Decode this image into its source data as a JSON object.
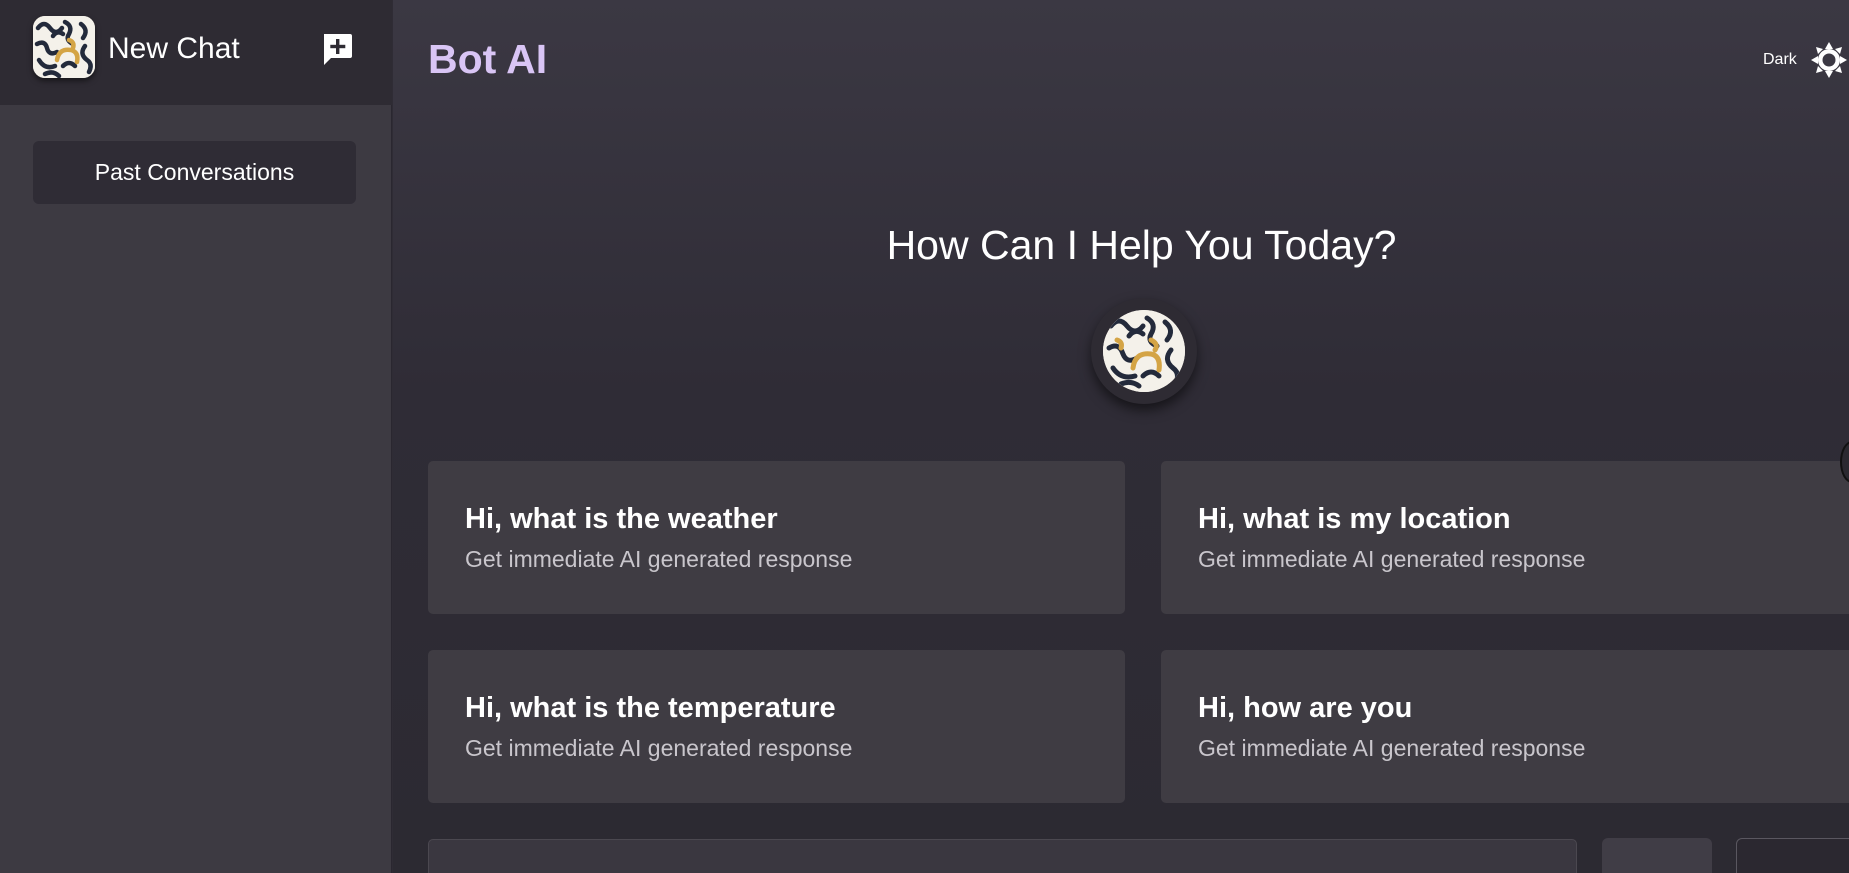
{
  "sidebar": {
    "logo_icon": "doodle-logo-icon",
    "new_chat_label": "New Chat",
    "new_chat_icon": "add-chat-icon",
    "past_conversations_label": "Past Conversations"
  },
  "header": {
    "title": "Bot AI",
    "theme_label": "Dark",
    "theme_icon": "sun-icon"
  },
  "main": {
    "headline": "How Can I Help You Today?",
    "avatar_icon": "doodle-logo-icon",
    "suggestions": [
      {
        "title": "Hi, what is the weather",
        "subtitle": "Get immediate AI generated response"
      },
      {
        "title": "Hi, what is my location",
        "subtitle": "Get immediate AI generated response"
      },
      {
        "title": "Hi, what is the temperature",
        "subtitle": "Get immediate AI generated response"
      },
      {
        "title": "Hi, how are you",
        "subtitle": "Get immediate AI generated response"
      }
    ]
  },
  "colors": {
    "sidebar_bg": "#3d3a42",
    "sidebar_header_bg": "#2e2b33",
    "main_bg": "#2f2c36",
    "card_bg": "#3f3c43",
    "title_accent": "#d9c5f5",
    "logo_bg": "#f4f1ea",
    "logo_ink": "#232a3b",
    "logo_accent": "#d4a445"
  }
}
